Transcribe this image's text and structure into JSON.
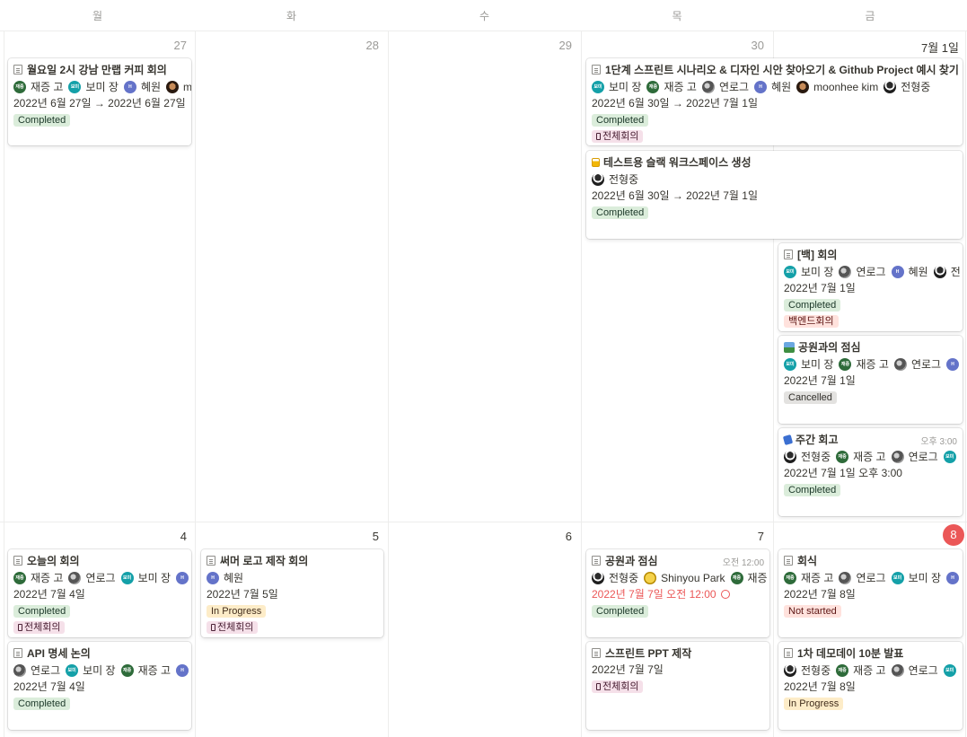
{
  "weekdays": [
    "월",
    "화",
    "수",
    "목",
    "금"
  ],
  "week1": {
    "days": [
      "27",
      "28",
      "29",
      "30",
      "7월 1일"
    ],
    "events": [
      {
        "title": "월요일 2시 강남 만랩 커피 회의",
        "people": [
          {
            "avatar": "재증",
            "name": "재증 고"
          },
          {
            "avatar": "보미",
            "name": "보미 장"
          },
          {
            "avatar": "H",
            "name": "혜원"
          },
          {
            "avatar": "",
            "name": "m"
          }
        ],
        "date": "2022년 6월 27일 → 2022년 6월 27일",
        "status": "Completed"
      },
      {
        "title": "1단계 스프린트 시나리오 & 디자인 시안 찾아오기 & Github Project 예시 찾기",
        "people": [
          {
            "avatar": "보미",
            "name": "보미 장"
          },
          {
            "avatar": "재증",
            "name": "재증 고"
          },
          {
            "avatar": "",
            "name": "연로그"
          },
          {
            "avatar": "H",
            "name": "혜원"
          },
          {
            "avatar": "",
            "name": "moonhee kim"
          },
          {
            "avatar": "",
            "name": "전형중"
          }
        ],
        "date": "2022년 6월 30일 → 2022년 7월 1일",
        "status": "Completed",
        "category": "전체회의"
      },
      {
        "title": "테스트용 슬랙 워크스페이스 생성",
        "people": [
          {
            "avatar": "",
            "name": "전형중"
          }
        ],
        "date": "2022년 6월 30일 → 2022년 7월 1일",
        "status": "Completed"
      },
      {
        "title": "[백] 회의",
        "people": [
          {
            "avatar": "보미",
            "name": "보미 장"
          },
          {
            "avatar": "",
            "name": "연로그"
          },
          {
            "avatar": "H",
            "name": "혜원"
          },
          {
            "avatar": "",
            "name": "전"
          }
        ],
        "date": "2022년 7월 1일",
        "status": "Completed",
        "category": "백엔드회의"
      },
      {
        "title": "공원과의 점심",
        "people": [
          {
            "avatar": "보미",
            "name": "보미 장"
          },
          {
            "avatar": "재증",
            "name": "재증 고"
          },
          {
            "avatar": "",
            "name": "연로그"
          },
          {
            "avatar": "H",
            "name": ""
          }
        ],
        "date": "2022년 7월 1일",
        "status": "Cancelled"
      },
      {
        "title": "주간 회고",
        "time": "오후 3:00",
        "people": [
          {
            "avatar": "",
            "name": "전형중"
          },
          {
            "avatar": "재증",
            "name": "재증 고"
          },
          {
            "avatar": "",
            "name": "연로그"
          },
          {
            "avatar": "보미",
            "name": ""
          }
        ],
        "date": "2022년 7월 1일 오후 3:00",
        "status": "Completed"
      }
    ]
  },
  "week2": {
    "days": [
      "4",
      "5",
      "6",
      "7",
      "8"
    ],
    "events": [
      {
        "title": "오늘의 회의",
        "people": [
          {
            "avatar": "재증",
            "name": "재증 고"
          },
          {
            "avatar": "",
            "name": "연로그"
          },
          {
            "avatar": "보미",
            "name": "보미 장"
          },
          {
            "avatar": "H",
            "name": ""
          }
        ],
        "date": "2022년 7월 4일",
        "status": "Completed",
        "category": "전체회의"
      },
      {
        "title": "API 명세 논의",
        "people": [
          {
            "avatar": "",
            "name": "연로그"
          },
          {
            "avatar": "보미",
            "name": "보미 장"
          },
          {
            "avatar": "재증",
            "name": "재증 고"
          },
          {
            "avatar": "H",
            "name": ""
          }
        ],
        "date": "2022년 7월 4일",
        "status": "Completed"
      },
      {
        "title": "써머 로고 제작 회의",
        "people": [
          {
            "avatar": "H",
            "name": "혜원"
          }
        ],
        "date": "2022년 7월 5일",
        "status": "In Progress",
        "category": "전체회의"
      },
      {
        "title": "공원과 점심",
        "time": "오전 12:00",
        "people": [
          {
            "avatar": "",
            "name": "전형중"
          },
          {
            "avatar": "",
            "name": "Shinyou Park"
          },
          {
            "avatar": "재증",
            "name": "재증 고"
          }
        ],
        "date": "2022년 7월 7일 오전 12:00",
        "status": "Completed"
      },
      {
        "title": "스프린트 PPT 제작",
        "people": [],
        "date": "2022년 7월 7일",
        "category": "전체회의"
      },
      {
        "title": "회식",
        "people": [
          {
            "avatar": "재증",
            "name": "재증 고"
          },
          {
            "avatar": "",
            "name": "연로그"
          },
          {
            "avatar": "보미",
            "name": "보미 장"
          },
          {
            "avatar": "H",
            "name": ""
          }
        ],
        "date": "2022년 7월 8일",
        "status": "Not started"
      },
      {
        "title": "1차 데모데이 10분 발표",
        "people": [
          {
            "avatar": "",
            "name": "전형중"
          },
          {
            "avatar": "재증",
            "name": "재증 고"
          },
          {
            "avatar": "",
            "name": "연로그"
          },
          {
            "avatar": "보미",
            "name": ""
          }
        ],
        "date": "2022년 7월 8일",
        "status": "In Progress"
      }
    ]
  },
  "colors": {
    "today": "#eb5757",
    "status_completed_bg": "#dbeddb",
    "status_in_progress_bg": "#fdecc8",
    "status_cancelled_bg": "#e3e2e0",
    "status_not_started_bg": "#ffe2dd",
    "category_all_meeting_bg": "#f5e0e9",
    "category_backend_bg": "#ffe2dd"
  }
}
